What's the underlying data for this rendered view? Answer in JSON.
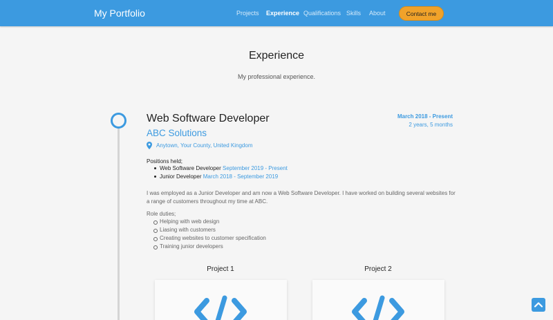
{
  "nav": {
    "brand": "My Portfolio",
    "links": [
      "Projects",
      "Experience",
      "Qualifications",
      "Skills",
      "About"
    ],
    "contact_label": "Contact me"
  },
  "section": {
    "title": "Experience",
    "subtitle": "My professional experience."
  },
  "job": {
    "title": "Web Software Developer",
    "company": "ABC Solutions",
    "location": "Anytown, Your County, United Kingdom",
    "date_range": "March 2018 - Present",
    "duration": "2 years, 5 months",
    "positions_label": "Positions held;",
    "positions": [
      {
        "role": "Web Software Developer",
        "dates": "September 2019 - Present"
      },
      {
        "role": "Junior Developer",
        "dates": "March 2018 - September 2019"
      }
    ],
    "description": "I was employed as a Junior Developer and am now a Web Software Developer. I have worked on building several websites for a range of customers throughout my time at ABC.",
    "duties_label": "Role duties;",
    "duties": [
      "Helping with web design",
      "Liasing with customers",
      "Creating websites to customer specification",
      "Training junior developers"
    ]
  },
  "projects": [
    "Project 1",
    "Project 2"
  ],
  "colors": {
    "primary": "#3c9ae0",
    "accent": "#f0a22a",
    "background": "#f5f5f5"
  },
  "icons": {
    "location": "map-pin-icon",
    "project": "code-icon",
    "scroll_top": "chevron-up-icon"
  }
}
